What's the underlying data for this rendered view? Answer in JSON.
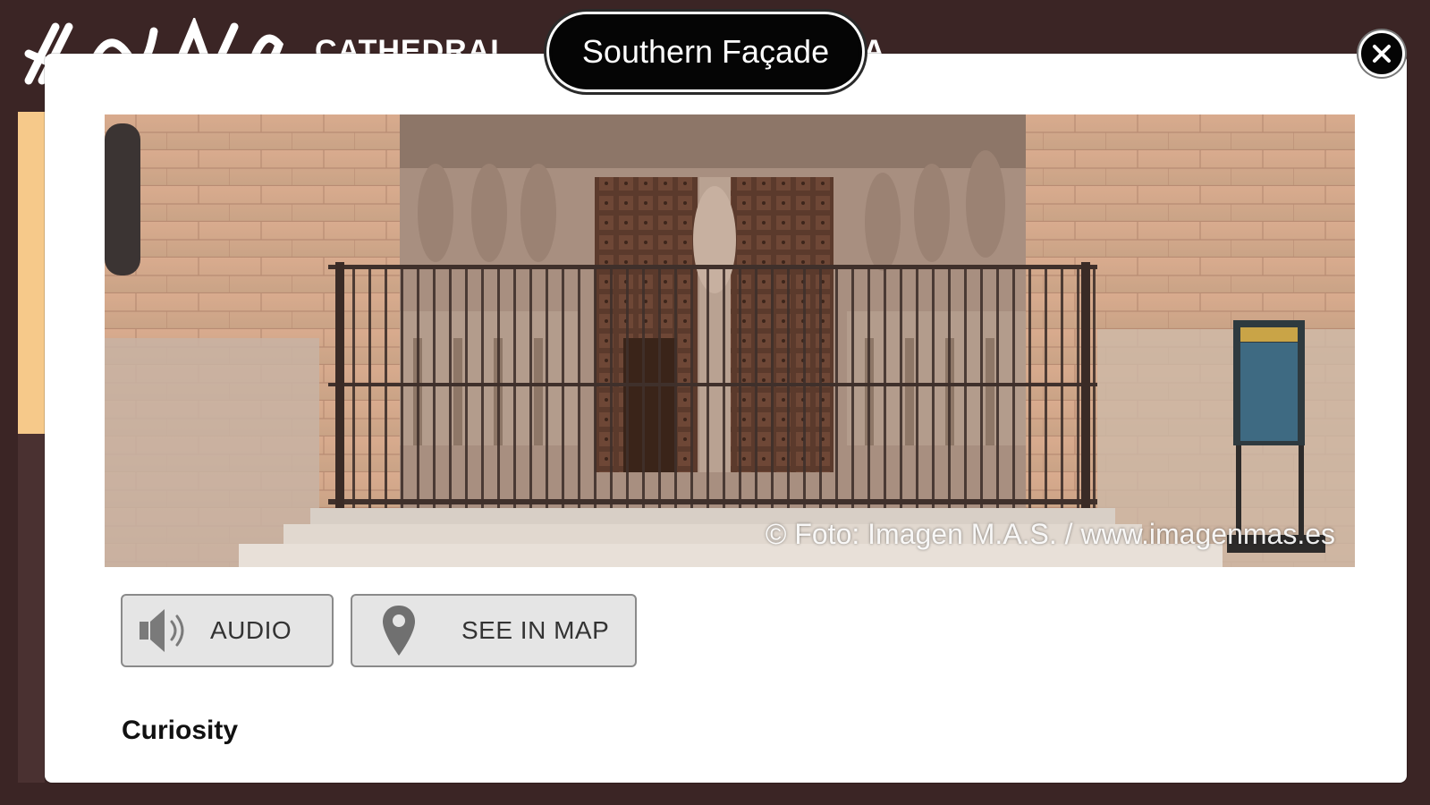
{
  "background": {
    "site_title": "CATHEDRAL",
    "site_title_tail": "A"
  },
  "modal": {
    "title": "Southern Façade",
    "close_label": "✕",
    "photo": {
      "alt": "Southern façade portal of the cathedral",
      "credit": "© Foto: Imagen M.A.S. / www.imagenmas.es"
    },
    "buttons": {
      "audio": {
        "label": "AUDIO",
        "icon": "speaker-icon"
      },
      "map": {
        "label": "SEE IN MAP",
        "icon": "map-pin-icon"
      }
    },
    "section_heading": "Curiosity"
  }
}
